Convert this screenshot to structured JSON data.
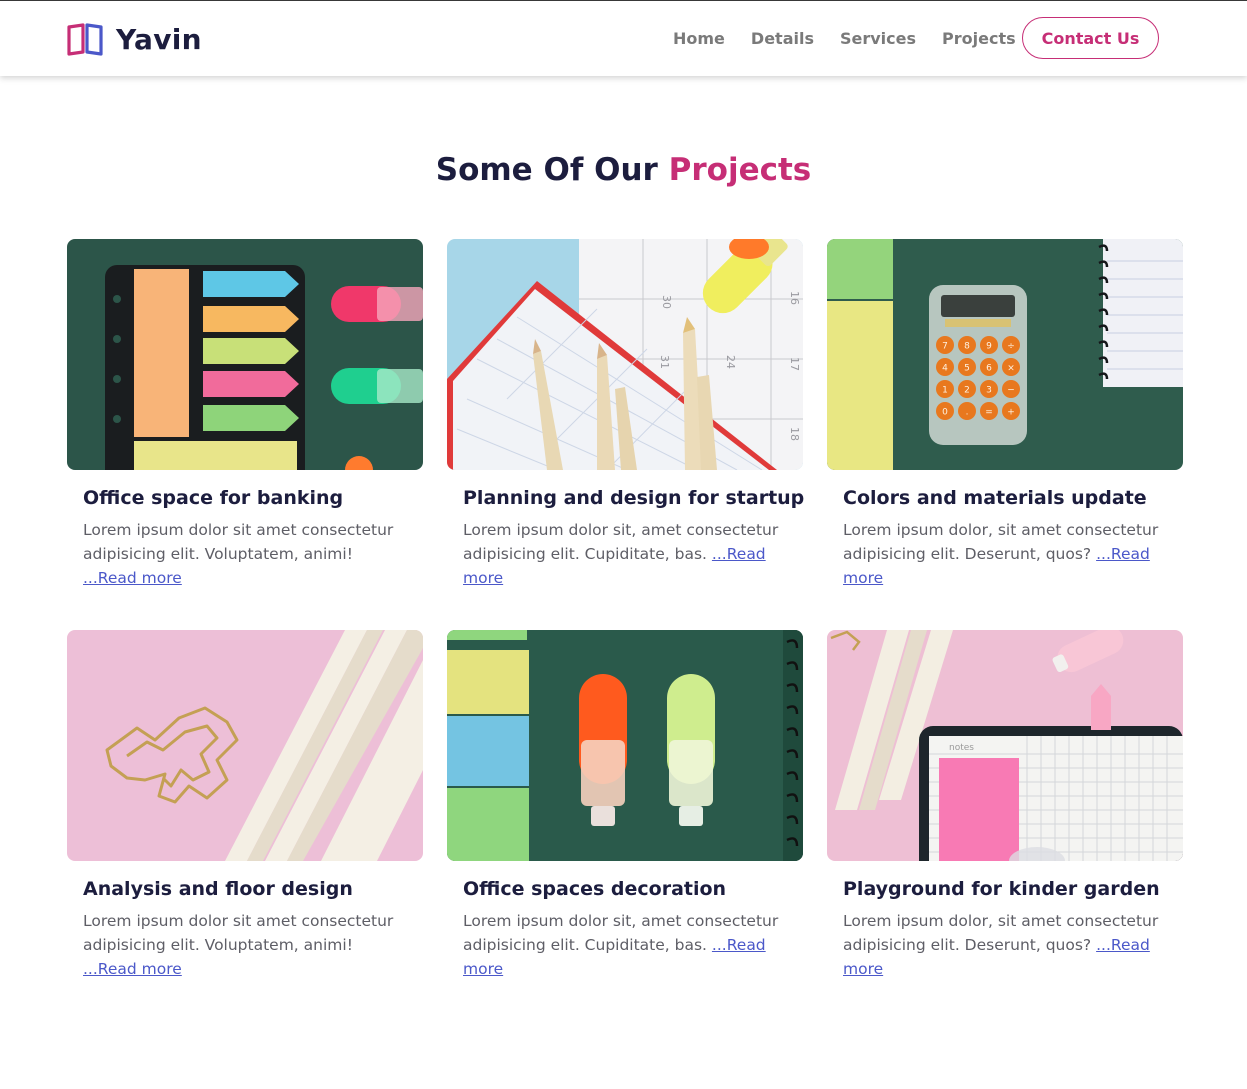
{
  "brand": {
    "name": "Yavin",
    "logo_icon": "book-icon",
    "colors": {
      "dark": "#1c1d3e",
      "accent": "#c62e76",
      "logo_left": "#c62e76",
      "logo_right": "#4b58c9",
      "link": "#4b58c9"
    }
  },
  "nav": {
    "items": [
      {
        "label": "Home"
      },
      {
        "label": "Details"
      },
      {
        "label": "Services"
      },
      {
        "label": "Projects"
      }
    ],
    "contact_label": "Contact Us"
  },
  "section": {
    "title_prefix": "Some Of Our ",
    "title_accent": "Projects"
  },
  "projects": [
    {
      "title": "Office space for banking",
      "desc": "Lorem ipsum dolor sit amet consectetur adipisicing elit. Voluptatem, animi! ",
      "link": "...Read more",
      "image": "sticky-notes-highlighters-photo"
    },
    {
      "title": "Planning and design for startup",
      "desc": "Lorem ipsum dolor sit, amet consectetur adipisicing elit. Cupiditate, bas. ",
      "link": "...Read more",
      "image": "calendar-pencils-photo"
    },
    {
      "title": "Colors and materials update",
      "desc": "Lorem ipsum dolor, sit amet consectetur adipisicing elit. Deserunt, quos? ",
      "link": "...Read more",
      "image": "calculator-notebook-photo"
    },
    {
      "title": "Analysis and floor design",
      "desc": "Lorem ipsum dolor sit amet consectetur adipisicing elit. Voluptatem, animi! ",
      "link": "...Read more",
      "image": "paperclips-pencils-photo"
    },
    {
      "title": "Office spaces decoration",
      "desc": "Lorem ipsum dolor sit, amet consectetur adipisicing elit. Cupiditate, bas. ",
      "link": "...Read more",
      "image": "highlighters-notebook-photo"
    },
    {
      "title": "Playground for kinder garden",
      "desc": "Lorem ipsum dolor, sit amet consectetur adipisicing elit. Deserunt, quos? ",
      "link": "...Read more",
      "image": "notes-notebook-photo"
    }
  ],
  "images": {
    "notes_label": "notes",
    "calendar_numbers": [
      "30",
      "16",
      "31",
      "24",
      "17",
      "18"
    ],
    "calculator_keys": [
      "7",
      "8",
      "9",
      "÷",
      "4",
      "5",
      "6",
      "×",
      "1",
      "2",
      "3",
      "−",
      "0",
      ".",
      "=",
      "+"
    ]
  }
}
